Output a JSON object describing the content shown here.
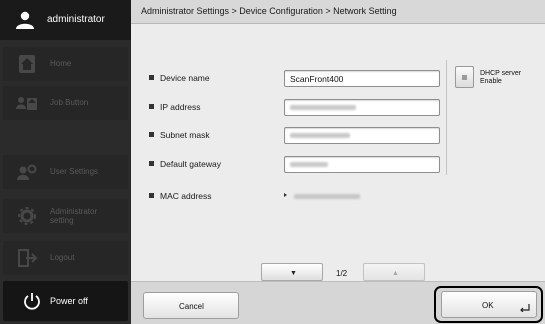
{
  "sidebar": {
    "user": {
      "icon": "user-icon",
      "label": "administrator"
    },
    "items": [
      {
        "key": "home",
        "icon": "home-icon",
        "label": "Home"
      },
      {
        "key": "job",
        "icon": "job-button-icon",
        "label": "Job Button"
      },
      {
        "key": "user_settings",
        "icon": "user-settings-icon",
        "label": "User Settings"
      },
      {
        "key": "admin",
        "icon": "gear-icon",
        "label": "Administrator setting"
      },
      {
        "key": "logout",
        "icon": "logout-icon",
        "label": "Logout"
      }
    ],
    "power": {
      "icon": "power-icon",
      "label": "Power off"
    }
  },
  "header": {
    "breadcrumb": "Administrator Settings > Device Configuration > Network Setting"
  },
  "form": {
    "device_name": {
      "label": "Device name",
      "value": "ScanFront400"
    },
    "ip_address": {
      "label": "IP address"
    },
    "subnet_mask": {
      "label": "Subnet mask"
    },
    "default_gateway": {
      "label": "Default gateway"
    },
    "mac_address": {
      "label": "MAC address"
    },
    "dhcp": {
      "label_line1": "DHCP server",
      "label_line2": "Enable",
      "enabled": false
    }
  },
  "pager": {
    "current": "1/2",
    "down_icon": "triangle-down-icon",
    "up_icon": "triangle-up-icon"
  },
  "footer": {
    "cancel_label": "Cancel",
    "ok_label": "OK",
    "enter_icon": "enter-key-icon"
  },
  "colors": {
    "sidebar": "#2b2b2b",
    "panel": "#ececec",
    "header": "#d8d8d8"
  }
}
